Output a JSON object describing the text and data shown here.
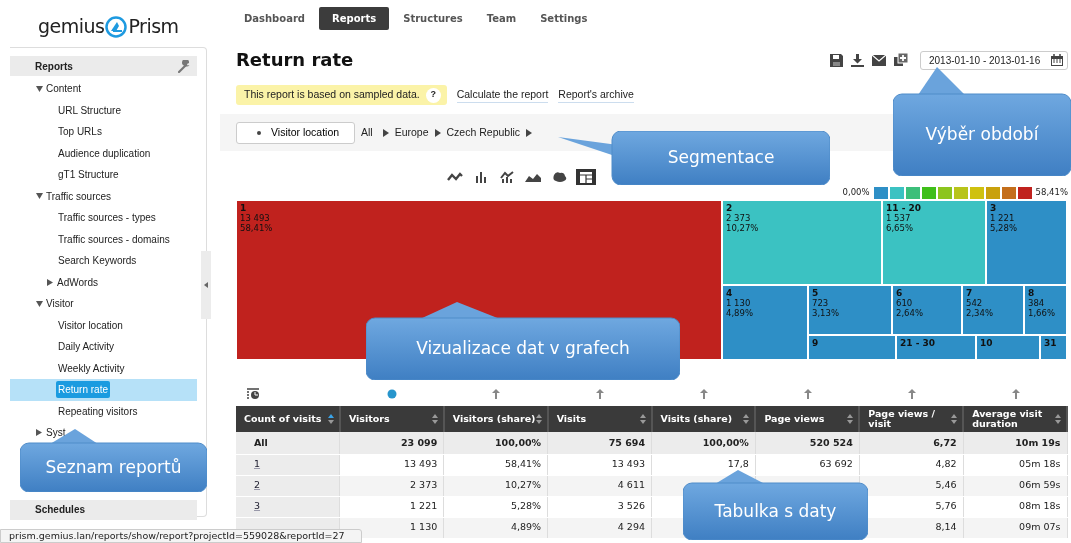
{
  "logo": {
    "left": "gemius",
    "right": "Prism"
  },
  "nav": [
    {
      "label": "Dashboard",
      "selected": false
    },
    {
      "label": "Reports",
      "selected": true
    },
    {
      "label": "Structures",
      "selected": false
    },
    {
      "label": "Team",
      "selected": false
    },
    {
      "label": "Settings",
      "selected": false
    }
  ],
  "sidebar": {
    "header": "Reports",
    "tree": [
      {
        "label": "Content",
        "kind": "folder",
        "expanded": true,
        "selected": false,
        "children": [
          {
            "label": "URL Structure",
            "kind": "report",
            "selected": false
          },
          {
            "label": "Top URLs",
            "kind": "report",
            "selected": false
          },
          {
            "label": "Audience duplication",
            "kind": "report",
            "selected": false
          },
          {
            "label": "gT1 Structure",
            "kind": "report",
            "selected": false
          }
        ]
      },
      {
        "label": "Traffic sources",
        "kind": "folder",
        "expanded": true,
        "selected": false,
        "children": [
          {
            "label": "Traffic sources - types",
            "kind": "report",
            "selected": false
          },
          {
            "label": "Traffic sources - domains",
            "kind": "report",
            "selected": false
          },
          {
            "label": "Search Keywords",
            "kind": "report",
            "selected": false
          },
          {
            "label": "AdWords",
            "kind": "folder",
            "expanded": false,
            "selected": false
          }
        ]
      },
      {
        "label": "Visitor",
        "kind": "folder",
        "expanded": true,
        "selected": false,
        "children": [
          {
            "label": "Visitor location",
            "kind": "report",
            "selected": false
          },
          {
            "label": "Daily Activity",
            "kind": "report",
            "selected": false
          },
          {
            "label": "Weekly Activity",
            "kind": "report",
            "selected": false
          },
          {
            "label": "Return rate",
            "kind": "report",
            "selected": true
          },
          {
            "label": "Repeating visitors",
            "kind": "report",
            "selected": false
          }
        ]
      },
      {
        "label": "Syst",
        "kind": "folder",
        "expanded": false,
        "selected": false
      }
    ],
    "footer_header": "Schedules"
  },
  "page": {
    "title": "Return rate",
    "notice": "This report is based on sampled data.",
    "help": "?",
    "links": [
      "Calculate the report",
      "Report's archive"
    ],
    "date_range": "2013-01-10 - 2013-01-16"
  },
  "segmentation": {
    "dimension": "Visitor location",
    "path": [
      "All",
      "Europe",
      "Czech Republic"
    ]
  },
  "chart_types": [
    {
      "kind": "line",
      "selected": false
    },
    {
      "kind": "bar",
      "selected": false
    },
    {
      "kind": "combo",
      "selected": false
    },
    {
      "kind": "area",
      "selected": false
    },
    {
      "kind": "map",
      "selected": false
    },
    {
      "kind": "treemap",
      "selected": true
    }
  ],
  "legend": {
    "min": "0,00%",
    "max": "58,41%",
    "swatches": [
      {
        "color": "#2e8fc6"
      },
      {
        "color": "#3bc2c2"
      },
      {
        "color": "#3cbf7a"
      },
      {
        "color": "#3fbf1a"
      },
      {
        "color": "#8cc51e"
      },
      {
        "color": "#b8c41a"
      },
      {
        "color": "#cfc10f"
      },
      {
        "color": "#c9a10c"
      },
      {
        "color": "#c46e1b"
      },
      {
        "color": "#c0221e"
      }
    ]
  },
  "treemap": [
    {
      "label": "1",
      "value": "13 493",
      "share": "58,41%",
      "color": "#c0221e"
    },
    {
      "label": "2",
      "value": "2 373",
      "share": "10,27%",
      "color": "#3bc2c2"
    },
    {
      "label": "11 - 20",
      "value": "1 537",
      "share": "6,65%",
      "color": "#3bc2c2"
    },
    {
      "label": "3",
      "value": "1 221",
      "share": "5,28%",
      "color": "#2e8fc6"
    },
    {
      "label": "4",
      "value": "1 130",
      "share": "4,89%",
      "color": "#2e8fc6"
    },
    {
      "label": "5",
      "value": "723",
      "share": "3,13%",
      "color": "#2e8fc6"
    },
    {
      "label": "6",
      "value": "610",
      "share": "2,64%",
      "color": "#2e8fc6"
    },
    {
      "label": "7",
      "value": "542",
      "share": "2,34%",
      "color": "#2e8fc6"
    },
    {
      "label": "8",
      "value": "384",
      "share": "1,66%",
      "color": "#2e8fc6"
    },
    {
      "label": "9",
      "color": "#2e8fc6"
    },
    {
      "label": "21 - 30",
      "color": "#2e8fc6"
    },
    {
      "label": "10",
      "color": "#2e8fc6"
    },
    {
      "label": "31",
      "color": "#2e8fc6"
    }
  ],
  "table": {
    "columns": [
      {
        "label": "Count of visits",
        "sorted": true
      },
      {
        "label": "Visitors",
        "sorted": false,
        "pinned": true
      },
      {
        "label": "Visitors (share)",
        "sorted": false,
        "pinned": false
      },
      {
        "label": "Visits",
        "sorted": false,
        "pinned": false
      },
      {
        "label": "Visits (share)",
        "sorted": false,
        "pinned": false
      },
      {
        "label": "Page views",
        "sorted": false,
        "pinned": false
      },
      {
        "label": "Page views / visit",
        "sorted": false,
        "pinned": false
      },
      {
        "label": "Average visit duration",
        "sorted": false,
        "pinned": false
      }
    ],
    "rows": [
      {
        "kind": "total",
        "cells": [
          "All",
          "23 099",
          "100,00%",
          "75 694",
          "100,00%",
          "520 524",
          "6,72",
          "10m 19s"
        ]
      },
      {
        "kind": "item",
        "cells": [
          "1",
          "13 493",
          "58,41%",
          "13 493",
          "17,8",
          "63 692",
          "4,82",
          "05m 18s"
        ]
      },
      {
        "kind": "item",
        "cells": [
          "2",
          "2 373",
          "10,27%",
          "4 611",
          null,
          null,
          "5,46",
          "06m 59s"
        ]
      },
      {
        "kind": "item",
        "cells": [
          "3",
          "1 221",
          "5,28%",
          "3 526",
          null,
          null,
          "5,76",
          "08m 18s"
        ]
      },
      {
        "kind": "item",
        "cells": [
          null,
          "1 130",
          "4,89%",
          "4 294",
          null,
          null,
          "8,14",
          "09m 07s"
        ]
      }
    ]
  },
  "status_url": "prism.gemius.lan/reports/show/report?projectId=559028&reportId=27",
  "callouts": [
    {
      "text": "Segmentace"
    },
    {
      "text": "Výběr období"
    },
    {
      "text": "Vizualizace dat v grafech"
    },
    {
      "text": "Seznam reportů"
    },
    {
      "text": "Tabulka s daty"
    }
  ]
}
